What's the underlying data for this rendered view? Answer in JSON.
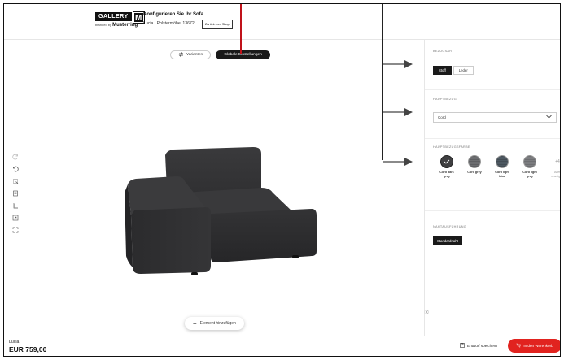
{
  "header": {
    "logo_gallery": "GALLERY",
    "logo_m": "M",
    "logo_branded_by": "branded by",
    "logo_musterring": "Musterring",
    "title": "Konfigurieren Sie Ihr Sofa",
    "subtitle": "Lucia | Polstermöbel 13672",
    "back_label": "Zurück zum Shop"
  },
  "view_toggle": {
    "variants_label": "Varianten",
    "global_label": "Globale Einstellungen",
    "active": "global"
  },
  "left_tools": [
    "redo-icon",
    "undo-icon",
    "rotate-icon",
    "notes-icon",
    "measure-icon",
    "expand-icon",
    "fit-icon"
  ],
  "add_element_label": "Element hinzufügen",
  "panel": {
    "cover_type": {
      "label": "BEZUGSART",
      "options": [
        "Stoff",
        "Leder"
      ],
      "selected": "Stoff"
    },
    "main_cover": {
      "label": "HAUPTBEZUG",
      "value": "Cord"
    },
    "main_color": {
      "label": "HAUPTBEZUGSFARBE",
      "swatches": [
        {
          "label_line1": "Cord dark",
          "label_line2": "grey",
          "color": "#3f3f41",
          "selected": true
        },
        {
          "label_line1": "Cord grey",
          "label_line2": "",
          "color": "#6c6d70",
          "selected": false
        },
        {
          "label_line1": "Cord light",
          "label_line2": "blue",
          "color": "#4d5861",
          "selected": false
        },
        {
          "label_line1": "Cord light",
          "label_line2": "grey",
          "color": "#7b7c7f",
          "selected": false
        }
      ],
      "more_count": "+4",
      "more_line1": "Alles",
      "more_line2": "anzeigen"
    },
    "stitching": {
      "label": "NAHTAUSFÜHRUNG",
      "value": "Standardnaht"
    }
  },
  "footer": {
    "product_name": "Lucia",
    "price": "EUR 759,00",
    "draft_label": "Entwurf speichern",
    "cart_label": "In den Warenkorb"
  },
  "colors": {
    "accent_red": "#e1231f",
    "dark": "#1a1a1a",
    "sofa": "#2f2f31"
  }
}
